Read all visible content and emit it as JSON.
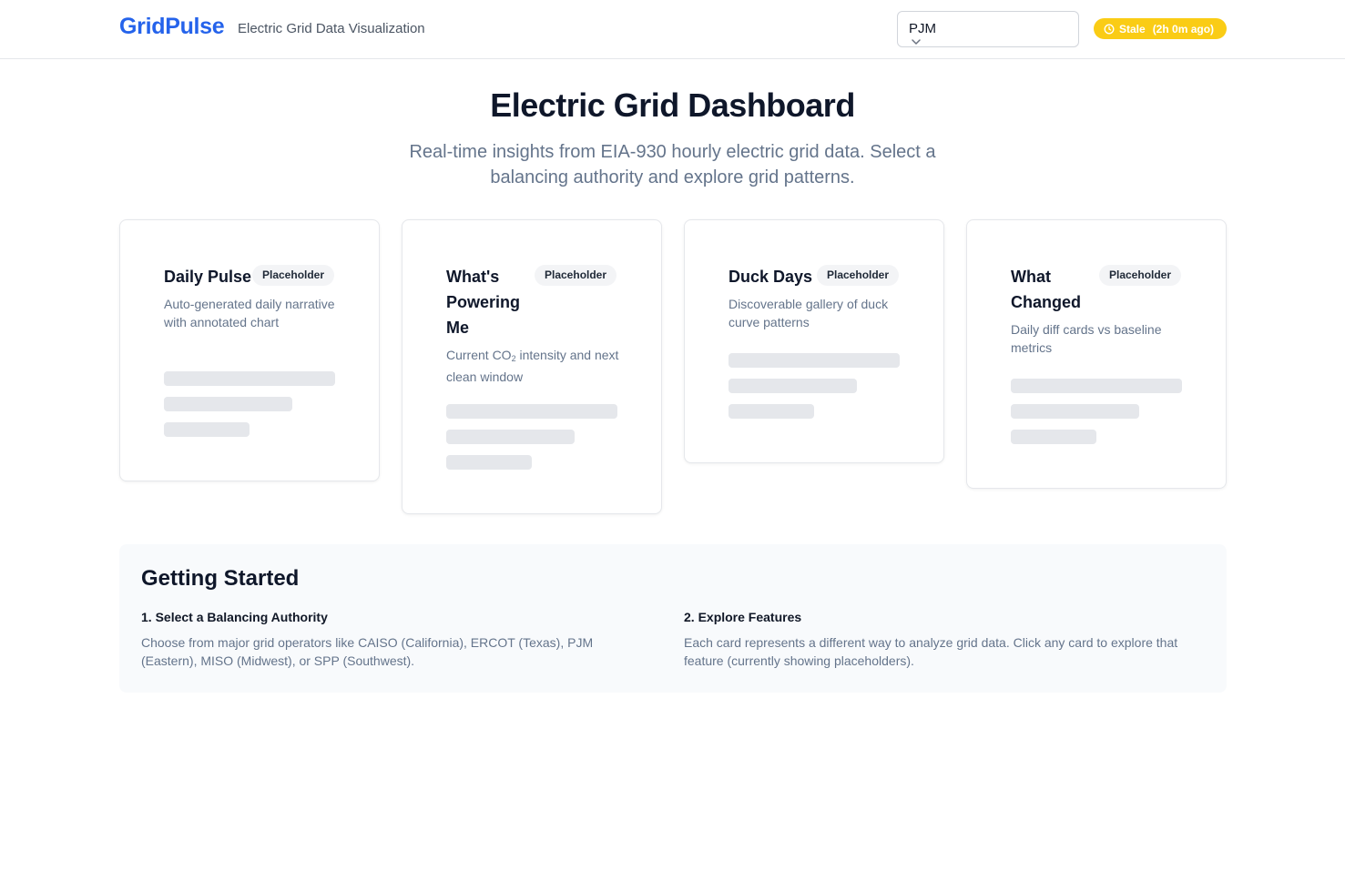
{
  "header": {
    "logo": "GridPulse",
    "tagline": "Electric Grid Data Visualization",
    "ba_select": {
      "value": "PJM"
    },
    "stale_badge": {
      "label": "Stale",
      "age": "(2h 0m ago)",
      "color": "#facc15"
    }
  },
  "hero": {
    "title": "Electric Grid Dashboard",
    "subtitle": "Real-time insights from EIA-930 hourly electric grid data. Select a balancing authority and explore grid patterns."
  },
  "cards": [
    {
      "title": "Daily Pulse",
      "badge": "Placeholder",
      "desc": "Auto-generated daily narrative with annotated chart"
    },
    {
      "title": "What's Powering Me",
      "badge": "Placeholder",
      "desc_prefix": "Current CO",
      "desc_sub": "2",
      "desc_suffix": " intensity and next clean window"
    },
    {
      "title": "Duck Days",
      "badge": "Placeholder",
      "desc": "Discoverable gallery of duck curve patterns"
    },
    {
      "title": "What Changed",
      "badge": "Placeholder",
      "desc": "Daily diff cards vs baseline metrics"
    }
  ],
  "getting_started": {
    "title": "Getting Started",
    "steps": [
      {
        "title": "1. Select a Balancing Authority",
        "text": "Choose from major grid operators like CAISO (California), ERCOT (Texas), PJM (Eastern), MISO (Midwest), or SPP (Southwest)."
      },
      {
        "title": "2. Explore Features",
        "text": "Each card represents a different way to analyze grid data. Click any card to explore that feature (currently showing placeholders)."
      }
    ]
  },
  "colors": {
    "brand": "#2563eb",
    "stale": "#facc15",
    "muted_text": "#64748b",
    "skeleton": "#e5e7eb"
  }
}
